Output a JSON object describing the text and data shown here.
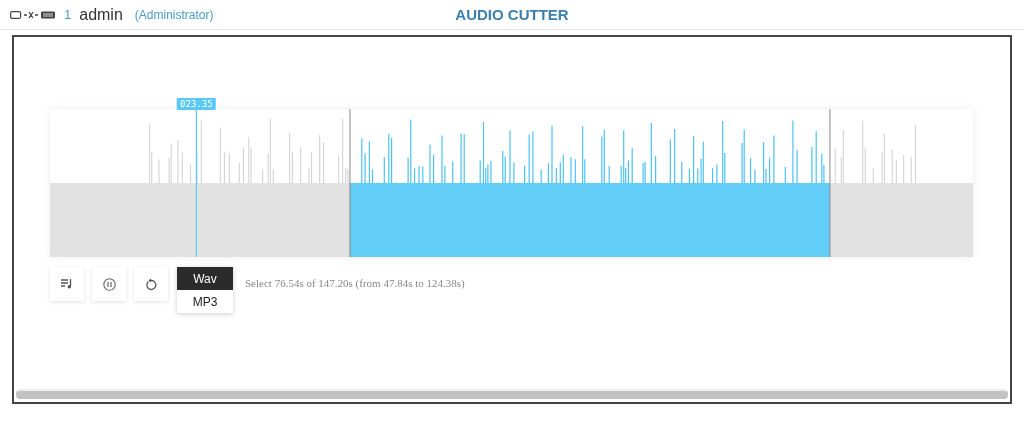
{
  "header": {
    "user_number": "1",
    "user_name": "admin",
    "role": "(Administrator)",
    "title": "AUDIO CUTTER"
  },
  "playhead": {
    "label": "023.35",
    "level": 0.1586
  },
  "controls": {
    "buttons": [
      {
        "kind": "playlist"
      },
      {
        "kind": "pause"
      },
      {
        "kind": "replay"
      }
    ],
    "format_options": [
      {
        "label": "Wav",
        "selected": true
      },
      {
        "label": "MP3",
        "selected": false
      }
    ],
    "status": "Select 76.54s of 147.20s (from 47.84s to 124.38s)"
  }
}
